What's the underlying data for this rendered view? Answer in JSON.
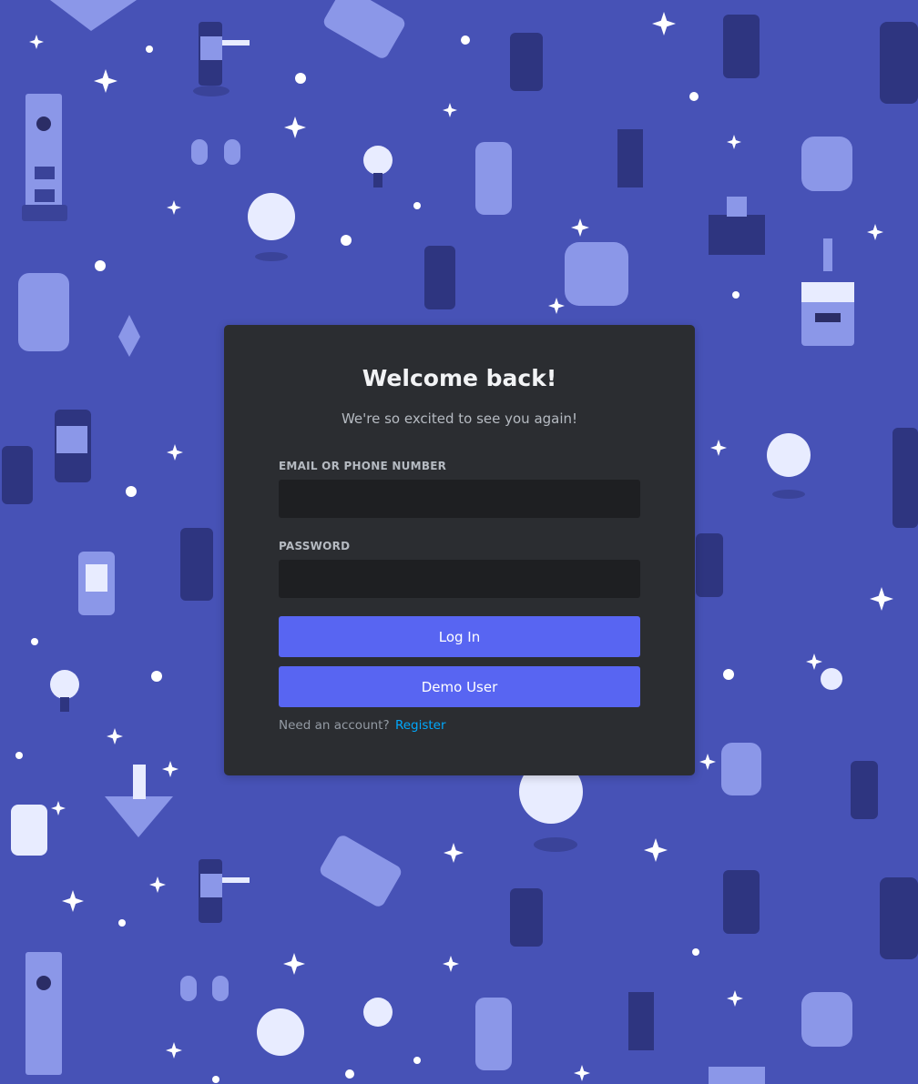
{
  "login": {
    "title": "Welcome back!",
    "subtitle": "We're so excited to see you again!",
    "email_label": "EMAIL OR PHONE NUMBER",
    "email_value": "",
    "password_label": "PASSWORD",
    "password_value": "",
    "login_button": "Log In",
    "demo_button": "Demo User",
    "register_prompt": "Need an account?",
    "register_link": "Register"
  },
  "colors": {
    "background": "#4752b6",
    "card": "#2b2d31",
    "input": "#1e1f22",
    "button": "#5865f2",
    "link": "#00a8fc"
  }
}
